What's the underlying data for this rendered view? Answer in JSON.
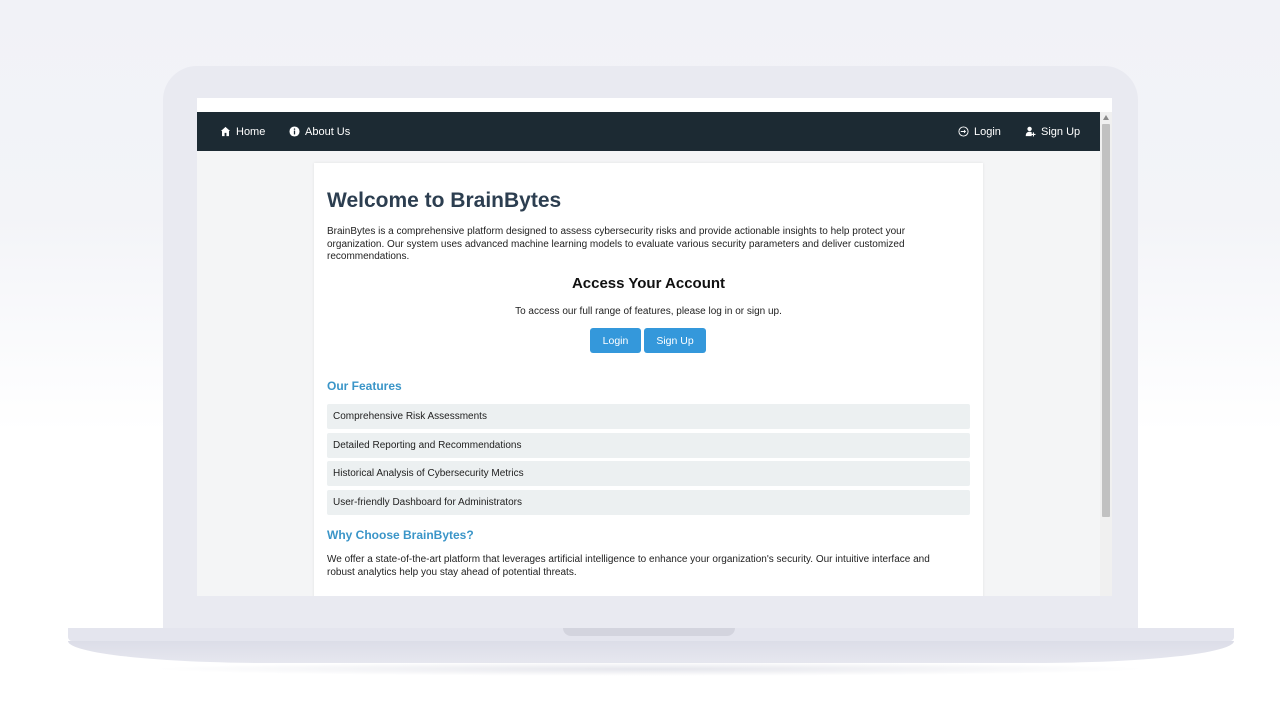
{
  "nav": {
    "home": "Home",
    "about": "About Us",
    "login": "Login",
    "signup": "Sign Up",
    "icons": {
      "home": "home-icon",
      "about": "info-icon",
      "login": "login-icon",
      "signup": "user-plus-icon"
    }
  },
  "main": {
    "title": "Welcome to BrainBytes",
    "intro": "BrainBytes is a comprehensive platform designed to assess cybersecurity risks and provide actionable insights to help protect your organization. Our system uses advanced machine learning models to evaluate various security parameters and deliver customized recommendations.",
    "access": {
      "title": "Access Your Account",
      "text": "To access our full range of features, please log in or sign up.",
      "login_label": "Login",
      "signup_label": "Sign Up"
    },
    "features": {
      "title": "Our Features",
      "items": [
        "Comprehensive Risk Assessments",
        "Detailed Reporting and Recommendations",
        "Historical Analysis of Cybersecurity Metrics",
        "User-friendly Dashboard for Administrators"
      ]
    },
    "why": {
      "title": "Why Choose BrainBytes?",
      "text": "We offer a state-of-the-art platform that leverages artificial intelligence to enhance your organization's security. Our intuitive interface and robust analytics help you stay ahead of potential threats."
    }
  },
  "colors": {
    "navbar": "#1c2a33",
    "accent": "#3498db",
    "section_title": "#3a95c8",
    "feature_bg": "#ecf0f1",
    "heading": "#2c3e50"
  }
}
